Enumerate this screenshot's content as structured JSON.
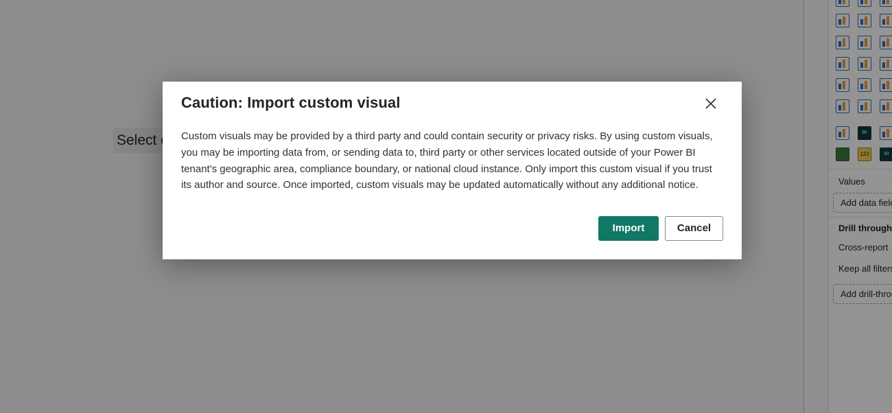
{
  "canvas": {
    "placeholder_text": "Select o"
  },
  "viz_pane": {
    "icons": [
      "line-chart-icon",
      "area-chart-icon",
      "stacked-area-icon",
      "line-clustered-column-icon",
      "ribbon-chart-icon",
      "funnel-icon",
      "treemap-icon",
      "map-icon",
      "filled-map-icon",
      "shape-map-icon",
      "table-icon",
      "matrix-icon",
      "trophy-icon",
      "paginated-report-icon",
      "smart-narrative-icon",
      "arcgis-map-icon",
      "power-apps-icon",
      "power-automate-icon",
      "qa-icon",
      "bi-visual-icon",
      "python-visual-icon",
      "card-visual-icon",
      "number-card-icon",
      "bi-custom-icon"
    ],
    "badges": {
      "bi": "BI",
      "num": "123"
    },
    "values_label": "Values",
    "values_well": "Add data fields here",
    "drill_through_label": "Drill through",
    "cross_report_label": "Cross-report",
    "keep_filters_label": "Keep all filters",
    "drill_well": "Add drill-through fields here"
  },
  "dialog": {
    "title": "Caution: Import custom visual",
    "body": "Custom visuals may be provided by a third party and could contain security or privacy risks. By using custom visuals, you may be importing data from, or sending data to, third party or other services located outside of your Power BI tenant's geographic area, compliance boundary, or national cloud instance. Only import this custom visual if you trust its author and source. Once imported, custom visuals may be updated automatically without any additional notice.",
    "import_label": "Import",
    "cancel_label": "Cancel"
  },
  "colors": {
    "primary": "#117865",
    "overlay": "rgba(0,0,0,0.42)"
  }
}
